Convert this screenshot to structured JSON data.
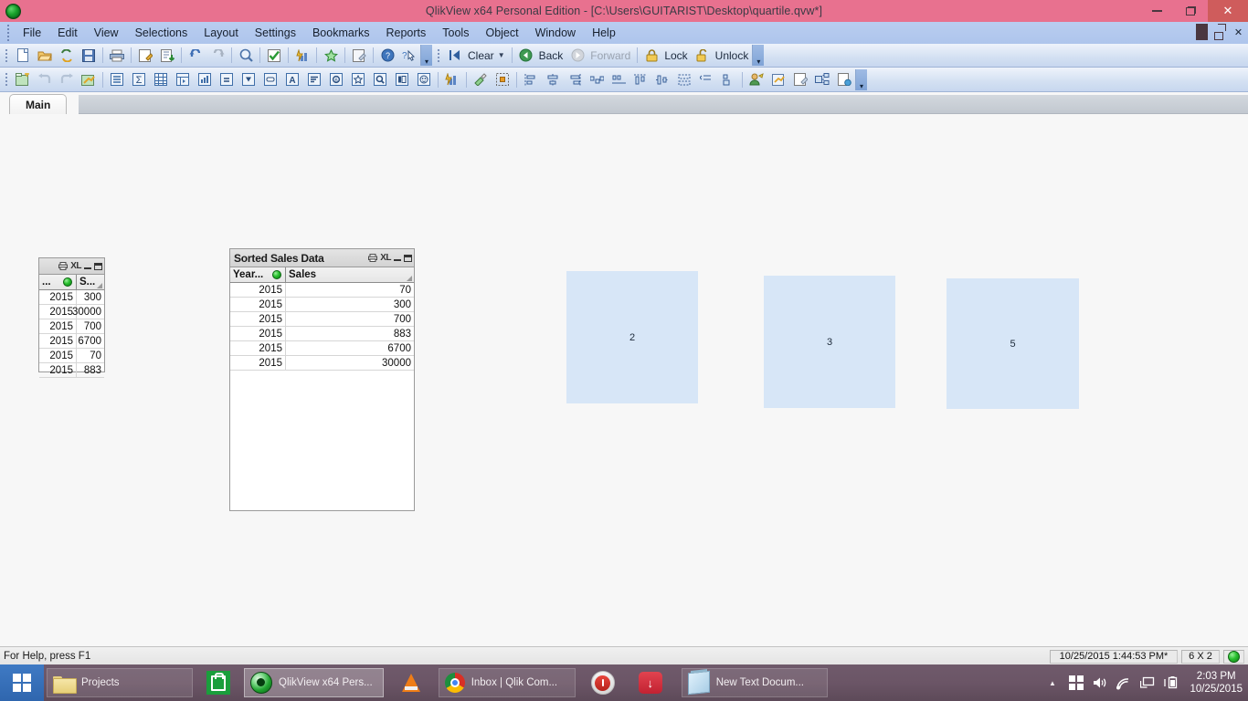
{
  "window": {
    "title": "QlikView x64 Personal Edition - [C:\\Users\\GUITARIST\\Desktop\\quartile.qvw*]",
    "logo_icon": "qlikview-logo-icon",
    "minimize_label": "–",
    "restore_label": "❐",
    "close_label": "✕"
  },
  "menu": {
    "items": [
      {
        "label": "File"
      },
      {
        "label": "Edit"
      },
      {
        "label": "View"
      },
      {
        "label": "Selections"
      },
      {
        "label": "Layout"
      },
      {
        "label": "Settings"
      },
      {
        "label": "Bookmarks"
      },
      {
        "label": "Reports"
      },
      {
        "label": "Tools"
      },
      {
        "label": "Object"
      },
      {
        "label": "Window"
      },
      {
        "label": "Help"
      }
    ],
    "mdi": {
      "minimize": "–",
      "restore": "❐",
      "close": "✕"
    }
  },
  "toolbar_main": {
    "icons": [
      {
        "name": "new-document-icon"
      },
      {
        "name": "open-document-icon"
      },
      {
        "name": "reload-icon"
      },
      {
        "name": "save-icon"
      },
      {
        "name": "print-icon"
      },
      {
        "name": "edit-script-icon"
      },
      {
        "name": "table-viewer-icon"
      },
      {
        "name": "undo-icon"
      },
      {
        "name": "redo-icon"
      },
      {
        "name": "search-icon"
      },
      {
        "name": "select-all-icon"
      },
      {
        "name": "quick-chart-wizard-icon"
      },
      {
        "name": "add-bookmark-icon"
      },
      {
        "name": "edit-module-icon"
      },
      {
        "name": "help-icon"
      },
      {
        "name": "context-help-icon"
      }
    ],
    "clear_label": "Clear",
    "clear_icon": "clear-selections-icon",
    "back_label": "Back",
    "back_icon": "back-arrow-icon",
    "forward_label": "Forward",
    "forward_icon": "forward-arrow-icon",
    "lock_label": "Lock",
    "lock_icon": "lock-icon",
    "unlock_label": "Unlock",
    "unlock_icon": "unlock-icon",
    "overflow_label": "»"
  },
  "toolbar_design": {
    "icons": [
      {
        "name": "new-sheet-icon"
      },
      {
        "name": "previous-sheet-icon"
      },
      {
        "name": "next-sheet-icon"
      },
      {
        "name": "sheet-properties-icon"
      },
      {
        "name": "new-list-box-icon"
      },
      {
        "name": "new-statistics-box-icon"
      },
      {
        "name": "new-table-box-icon"
      },
      {
        "name": "new-pivot-table-icon"
      },
      {
        "name": "new-chart-icon"
      },
      {
        "name": "new-expression-box-icon"
      },
      {
        "name": "new-multi-box-icon"
      },
      {
        "name": "new-input-box-icon"
      },
      {
        "name": "new-text-object-icon"
      },
      {
        "name": "new-current-selections-icon"
      },
      {
        "name": "new-slider-icon"
      },
      {
        "name": "new-bookmark-object-icon"
      },
      {
        "name": "new-search-object-icon"
      },
      {
        "name": "new-container-icon"
      },
      {
        "name": "new-custom-object-icon"
      },
      {
        "name": "quick-chart-icon"
      },
      {
        "name": "format-painter-icon"
      },
      {
        "name": "grid-icon"
      },
      {
        "name": "align-left-icon"
      },
      {
        "name": "align-center-horizontal-icon"
      },
      {
        "name": "align-right-icon"
      },
      {
        "name": "distribute-horizontal-icon"
      },
      {
        "name": "space-horizontal-icon"
      },
      {
        "name": "align-top-icon"
      },
      {
        "name": "align-middle-icon"
      },
      {
        "name": "distribute-vertical-icon"
      },
      {
        "name": "space-vertical-icon"
      },
      {
        "name": "resize-icon"
      },
      {
        "name": "user-preferences-icon"
      },
      {
        "name": "document-properties-icon"
      },
      {
        "name": "sheet-properties-2-icon"
      },
      {
        "name": "object-layout-icon"
      },
      {
        "name": "publish-icon"
      }
    ],
    "overflow_label": "»"
  },
  "sheet": {
    "tabs": [
      {
        "label": "Main",
        "active": true
      }
    ]
  },
  "objects": {
    "sales_list_box": {
      "caption_icons": [
        "print-icon",
        "XL",
        "minimize-icon",
        "maximize-icon"
      ],
      "xl_label": "XL",
      "columns": [
        {
          "label": "...",
          "has_green_dot": true
        },
        {
          "label": "S...",
          "has_sort_mark": true
        }
      ],
      "rows": [
        {
          "year": "2015",
          "sales": "300"
        },
        {
          "year": "2015",
          "sales": "30000"
        },
        {
          "year": "2015",
          "sales": "700"
        },
        {
          "year": "2015",
          "sales": "6700"
        },
        {
          "year": "2015",
          "sales": "70"
        },
        {
          "year": "2015",
          "sales": "883"
        }
      ]
    },
    "sorted_sales_table": {
      "title": "Sorted Sales Data",
      "xl_label": "XL",
      "columns": [
        {
          "label": "Year...",
          "has_green_dot": true
        },
        {
          "label": "Sales",
          "has_sort_mark": true
        }
      ],
      "rows": [
        {
          "year": "2015",
          "sales": "70"
        },
        {
          "year": "2015",
          "sales": "300"
        },
        {
          "year": "2015",
          "sales": "700"
        },
        {
          "year": "2015",
          "sales": "883"
        },
        {
          "year": "2015",
          "sales": "6700"
        },
        {
          "year": "2015",
          "sales": "30000"
        }
      ]
    },
    "text_boxes": [
      {
        "name": "text-object-quartile-1",
        "value": "2"
      },
      {
        "name": "text-object-quartile-2",
        "value": "3"
      },
      {
        "name": "text-object-quartile-3",
        "value": "5"
      }
    ],
    "text_box_color": "#d7e6f7"
  },
  "statusbar": {
    "help_text": "For Help, press F1",
    "timestamp": "10/25/2015 1:44:53 PM*",
    "dimensions": "6 X 2",
    "indicator": "green"
  },
  "taskbar": {
    "start_icon": "windows-start-icon",
    "buttons": [
      {
        "name": "taskbar-projects",
        "label": "Projects",
        "icon": "folder-icon",
        "active": false,
        "icon_only": false
      },
      {
        "name": "taskbar-store",
        "label": "",
        "icon": "store-icon",
        "active": false,
        "icon_only": true
      },
      {
        "name": "taskbar-qlikview",
        "label": "QlikView x64 Pers...",
        "icon": "qlikview-icon",
        "active": true,
        "icon_only": false
      },
      {
        "name": "taskbar-vlc",
        "label": "",
        "icon": "vlc-icon",
        "active": false,
        "icon_only": true
      },
      {
        "name": "taskbar-chrome",
        "label": "Inbox | Qlik Com...",
        "icon": "chrome-icon",
        "active": false,
        "icon_only": false
      },
      {
        "name": "taskbar-power",
        "label": "",
        "icon": "power-icon",
        "active": false,
        "icon_only": true
      },
      {
        "name": "taskbar-downloader",
        "label": "",
        "icon": "download-icon",
        "active": false,
        "icon_only": true
      },
      {
        "name": "taskbar-notepad",
        "label": "New Text Docum...",
        "icon": "notepad-icon",
        "active": false,
        "icon_only": false
      }
    ],
    "tray": {
      "show_hidden_label": "▲",
      "icons": [
        "windows-tray-icon",
        "volume-icon",
        "network-icon",
        "display-icon",
        "battery-icon"
      ],
      "time": "2:03 PM",
      "date": "10/25/2015"
    }
  },
  "colors": {
    "titlebar": "#e8718f",
    "menubar": "#b9cdf0",
    "close_button": "#cf5c5c",
    "taskbar": "#6b5566",
    "text_object": "#d7e6f7"
  }
}
